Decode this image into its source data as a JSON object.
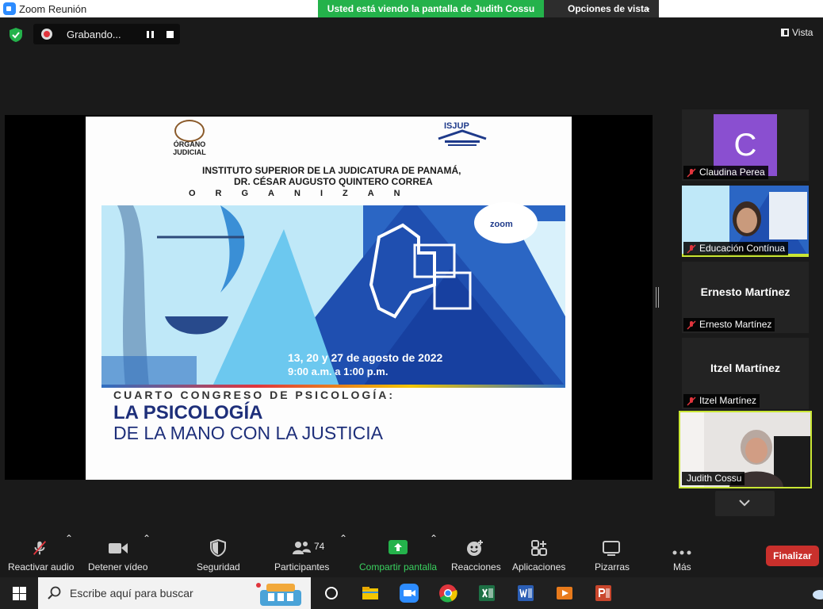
{
  "window": {
    "title": "Zoom Reunión"
  },
  "share_banner": {
    "text": "Usted está viendo la pantalla de Judith Cossu"
  },
  "view_options": {
    "label": "Opciones de vista"
  },
  "recording": {
    "label": "Grabando..."
  },
  "view": {
    "label": "Vista"
  },
  "slide": {
    "org_line1": "ÓRGANO",
    "org_line2": "JUDICIAL",
    "isjup": "ISJUP",
    "institute_line1": "INSTITUTO SUPERIOR DE LA JUDICATURA DE PANAMÁ,",
    "institute_line2": "DR. CÉSAR AUGUSTO QUINTERO CORREA",
    "organizan": "ORGANIZAN",
    "zoom_label": "zoom",
    "dates": "13, 20 y 27 de agosto de 2022",
    "hours": "9:00 a.m. a 1:00 p.m.",
    "congreso": "CUARTO CONGRESO DE PSICOLOGÍA:",
    "title_line1": "LA PSICOLOGÍA",
    "title_line2": "DE LA MANO CON LA JUSTICIA"
  },
  "participants_panel": [
    {
      "name": "Claudina Perea",
      "avatar_letter": "C",
      "muted": true,
      "type": "avatar"
    },
    {
      "name": "Educación Contínua",
      "muted": true,
      "type": "video"
    },
    {
      "name": "Ernesto Martínez",
      "display_name": "Ernesto Martínez",
      "muted": true,
      "type": "name"
    },
    {
      "name": "Itzel Martínez",
      "display_name": "Itzel Martínez",
      "muted": true,
      "type": "name"
    },
    {
      "name": "Judith Cossu",
      "muted": false,
      "type": "video",
      "active_speaker": true
    }
  ],
  "toolbar": {
    "audio": "Reactivar audio",
    "video": "Detener vídeo",
    "security": "Seguridad",
    "participants": "Participantes",
    "participants_count": "74",
    "share": "Compartir pantalla",
    "reactions": "Reacciones",
    "apps": "Aplicaciones",
    "whiteboards": "Pizarras",
    "more": "Más",
    "end": "Finalizar"
  },
  "taskbar": {
    "search_placeholder": "Escribe aquí para buscar"
  },
  "colors": {
    "share_green": "#24b24b",
    "end_red": "#c9302c",
    "active_border": "#c9e634",
    "avatar_purple": "#8a4fd0"
  }
}
